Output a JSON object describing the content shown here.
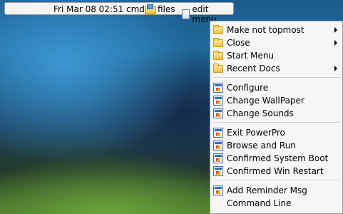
{
  "taskbar": {
    "clock": "Fri Mar 08 02:51",
    "cmd_label": "cmd",
    "files_label": "files",
    "edit_menu_label": "edit menu"
  },
  "menu": {
    "groups": [
      [
        {
          "label": "Make not topmost",
          "icon": "folder-icon",
          "submenu": true
        },
        {
          "label": "Close",
          "icon": "folder-icon",
          "submenu": true
        },
        {
          "label": "Start Menu",
          "icon": "folder-icon",
          "submenu": false
        },
        {
          "label": "Recent Docs",
          "icon": "folder-icon",
          "submenu": true
        }
      ],
      [
        {
          "label": "Configure",
          "icon": "program-icon",
          "submenu": false
        },
        {
          "label": "Change WallPaper",
          "icon": "program-icon",
          "submenu": false
        },
        {
          "label": "Change Sounds",
          "icon": "program-icon",
          "submenu": false
        }
      ],
      [
        {
          "label": "Exit PowerPro",
          "icon": "program-icon",
          "submenu": false
        },
        {
          "label": "Browse and Run",
          "icon": "program-icon",
          "submenu": false
        },
        {
          "label": "Confirmed System Boot",
          "icon": "program-icon",
          "submenu": false
        },
        {
          "label": "Confirmed Win Restart",
          "icon": "program-icon",
          "submenu": false
        }
      ],
      [
        {
          "label": "Add Reminder Msg",
          "icon": "program-icon",
          "submenu": false
        },
        {
          "label": "Command Line",
          "icon": "",
          "submenu": false
        }
      ]
    ]
  },
  "colors": {
    "menu_background": "#f6f6f6",
    "taskbar_background": "#f4f4f4"
  }
}
